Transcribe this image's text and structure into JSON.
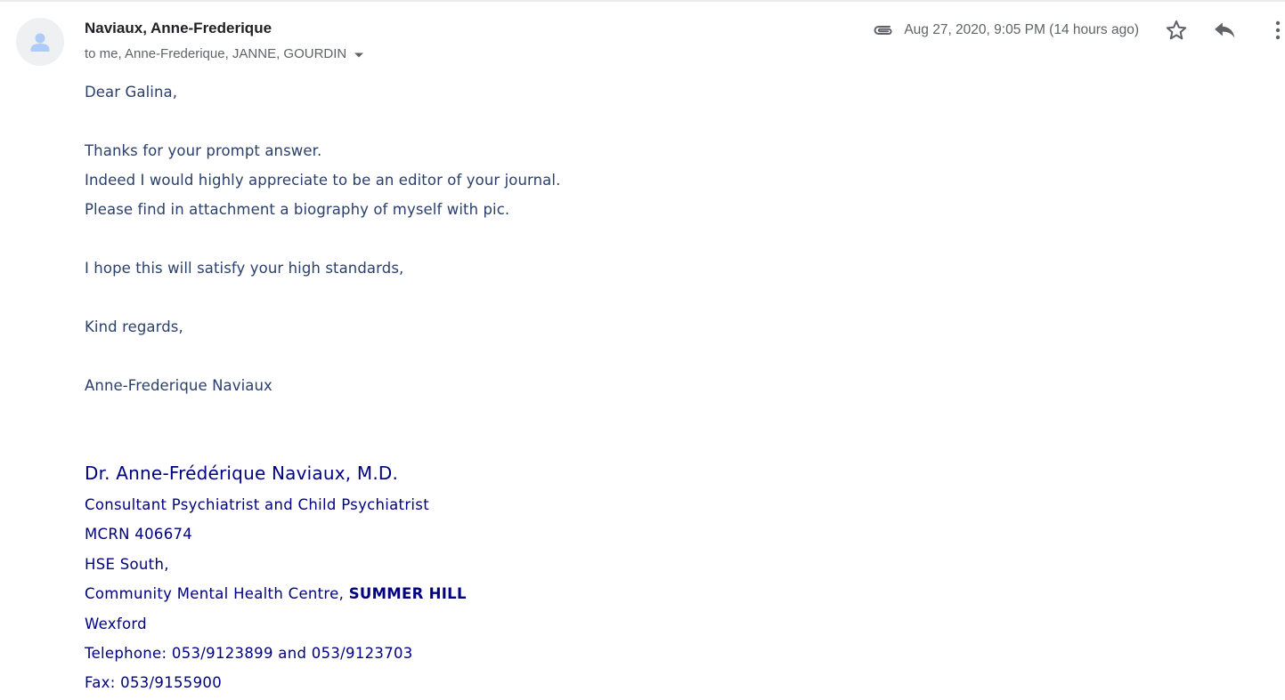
{
  "message": {
    "sender_name": "Naviaux, Anne-Frederique",
    "recipients": "to me, Anne-Frederique, JANNE, GOURDIN",
    "date": "Aug 27, 2020, 9:05 PM (14 hours ago)",
    "has_attachment": true
  },
  "body": {
    "lines": [
      "Dear Galina,",
      "",
      "Thanks for your prompt answer.",
      "Indeed I would highly appreciate to be an editor of your journal.",
      "Please find in attachment a biography of myself with pic.",
      "",
      "I hope this will satisfy your high standards,",
      "",
      "Kind regards,",
      "",
      "Anne-Frederique Naviaux"
    ]
  },
  "signature": {
    "name": "Dr. Anne-Frédérique Naviaux, M.D.",
    "title": "Consultant Psychiatrist and Child Psychiatrist",
    "mcrn": "MCRN 406674",
    "org": "HSE South,",
    "centre_prefix": "Community Mental Health Centre,",
    "centre_name": "SUMMER HILL",
    "town": "Wexford",
    "telephone": "Telephone: 053/9123899 and  053/9123703",
    "fax": "Fax: 053/9155900"
  },
  "icons": {
    "avatar": "default-person-avatar",
    "attachment": "paperclip-icon",
    "star": "star-outline-icon",
    "reply": "reply-icon",
    "more": "more-vertical-icon",
    "recipients_toggle": "caret-down-icon"
  },
  "colors": {
    "sender": "#202124",
    "secondary_text": "#5f6368",
    "body_text": "#2a3f6b",
    "signature_text": "#000080"
  }
}
